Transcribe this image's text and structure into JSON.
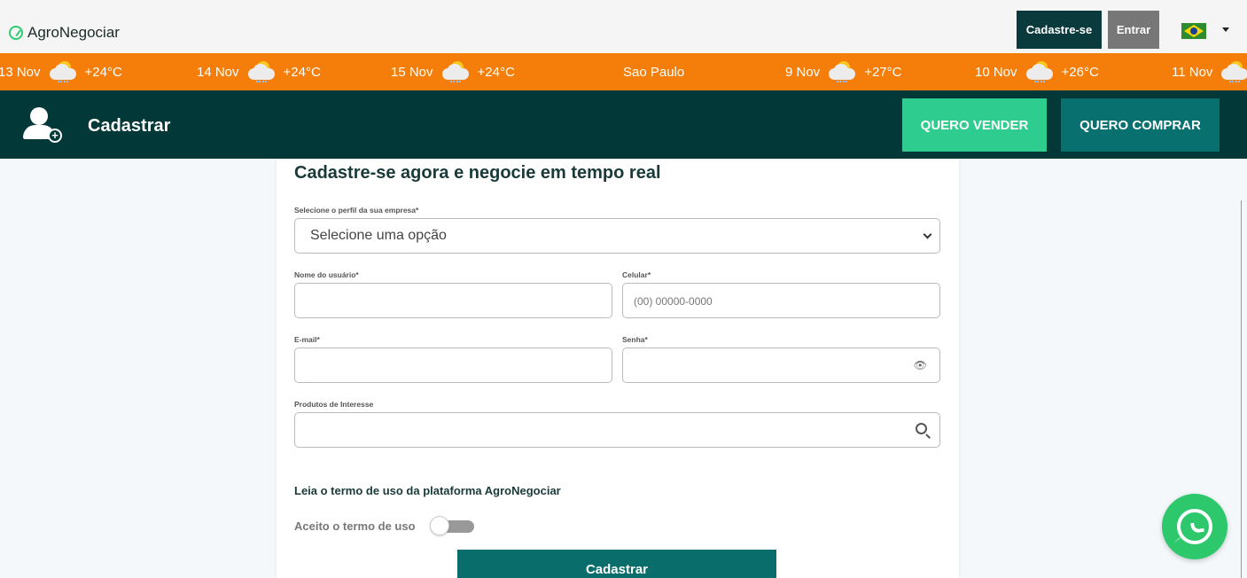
{
  "topbar": {
    "logo": "AgroNegociar",
    "signup_label": "Cadastre-se",
    "login_label": "Entrar",
    "flag_icon": "brazil-flag-icon"
  },
  "weather": {
    "items": [
      {
        "date": "13 Nov",
        "temp": "+24°C"
      },
      {
        "date": "14 Nov",
        "temp": "+24°C"
      },
      {
        "date": "15 Nov",
        "temp": "+24°C"
      },
      {
        "city": "Sao Paulo"
      },
      {
        "date": "9 Nov",
        "temp": "+27°C"
      },
      {
        "date": "10 Nov",
        "temp": "+26°C"
      },
      {
        "date": "11 Nov"
      }
    ],
    "background": "#f47e09"
  },
  "header": {
    "title": "Cadastrar",
    "sell_label": "QUERO VENDER",
    "buy_label": "QUERO COMPRAR",
    "background": "#033838"
  },
  "form": {
    "title": "Cadastre-se agora e negocie em tempo real",
    "profile_label": "Selecione o perfil da sua empresa*",
    "profile_value": "Selecione uma opção",
    "username_label": "Nome do usuário*",
    "username_value": "",
    "phone_label": "Celular*",
    "phone_placeholder": "(00) 00000-0000",
    "email_label": "E-mail*",
    "email_value": "",
    "password_label": "Senha*",
    "password_value": "",
    "products_label": "Produtos de Interesse",
    "products_value": "",
    "terms_link": "Leia o termo de uso da plataforma AgroNegociar",
    "accept_label": "Aceito o termo de uso",
    "accept_checked": false,
    "submit_label": "Cadastrar"
  }
}
